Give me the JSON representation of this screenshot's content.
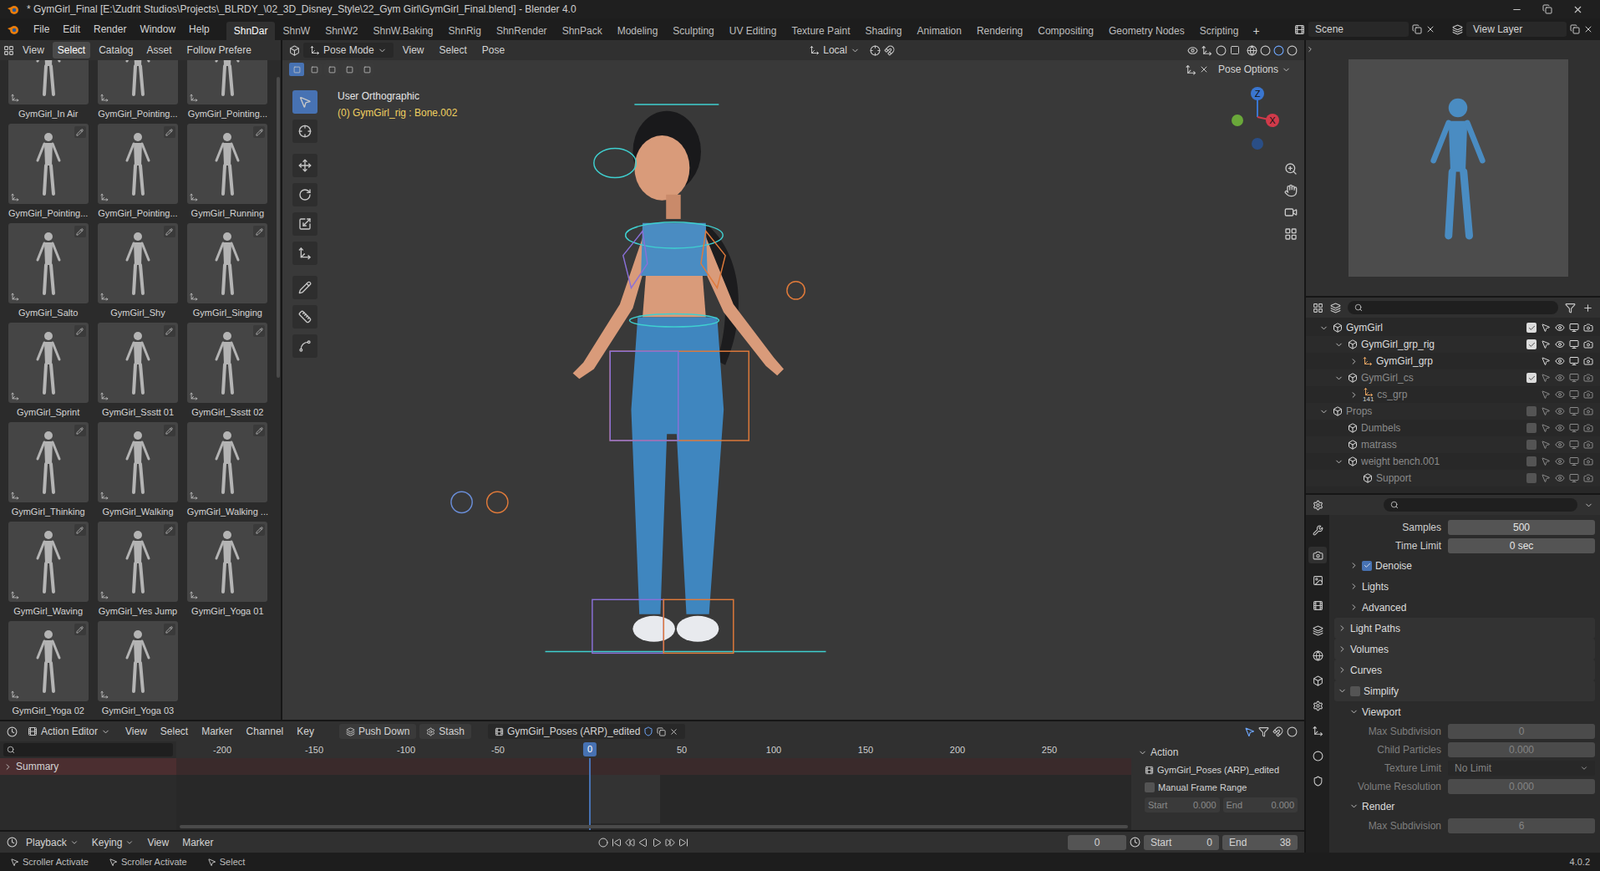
{
  "window": {
    "title": "* GymGirl_Final [E:\\Zudrit Studios\\Projects\\_BLRDY_\\02_3D_Disney_Style\\22_Gym Girl\\GymGirl_Final.blend] - Blender 4.0"
  },
  "menu": [
    "File",
    "Edit",
    "Render",
    "Window",
    "Help"
  ],
  "workspaces": [
    {
      "label": "ShnDar",
      "selected": true
    },
    {
      "label": "ShnW",
      "selected": false
    },
    {
      "label": "ShnW2",
      "selected": false
    },
    {
      "label": "ShnW.Baking",
      "selected": false
    },
    {
      "label": "ShnRig",
      "selected": false
    },
    {
      "label": "ShnRender",
      "selected": false
    },
    {
      "label": "ShnPack",
      "selected": false
    },
    {
      "label": "Modeling",
      "selected": false
    },
    {
      "label": "Sculpting",
      "selected": false
    },
    {
      "label": "UV Editing",
      "selected": false
    },
    {
      "label": "Texture Paint",
      "selected": false
    },
    {
      "label": "Shading",
      "selected": false
    },
    {
      "label": "Animation",
      "selected": false
    },
    {
      "label": "Rendering",
      "selected": false
    },
    {
      "label": "Compositing",
      "selected": false
    },
    {
      "label": "Geometry Nodes",
      "selected": false
    },
    {
      "label": "Scripting",
      "selected": false
    }
  ],
  "add_workspace": "+",
  "scene": "Scene",
  "view_layer": "View Layer",
  "asset_browser": {
    "menu": [
      {
        "label": "View",
        "selected": false
      },
      {
        "label": "Select",
        "selected": true
      },
      {
        "label": "Catalog",
        "selected": false
      },
      {
        "label": "Asset",
        "selected": false
      }
    ],
    "follow": "Follow Prefere",
    "assets": [
      "GymGirl_In Air",
      "GymGirl_Pointing...",
      "GymGirl_Pointing...",
      "GymGirl_Pointing...",
      "GymGirl_Pointing...",
      "GymGirl_Running",
      "GymGirl_Salto",
      "GymGirl_Shy",
      "GymGirl_Singing",
      "GymGirl_Sprint",
      "GymGirl_Ssstt 01",
      "GymGirl_Ssstt 02",
      "GymGirl_Thinking",
      "GymGirl_Walking",
      "GymGirl_Walking ...",
      "GymGirl_Waving",
      "GymGirl_Yes Jump",
      "GymGirl_Yoga 01",
      "GymGirl_Yoga 02",
      "GymGirl_Yoga 03"
    ]
  },
  "viewport": {
    "mode": "Pose Mode",
    "menu": [
      "View",
      "Select",
      "Pose"
    ],
    "orientation": "Local",
    "options": "Pose Options",
    "view_name": "User Orthographic",
    "active": "(0) GymGirl_rig : Bone.002",
    "gizmo_z": "Z",
    "gizmo_x": "X"
  },
  "outliner": {
    "items": [
      {
        "name": "GymGirl",
        "kind": "collection",
        "depth": 0,
        "has_children": true,
        "expanded": true,
        "checked": true,
        "disabled": false
      },
      {
        "name": "GymGirl_grp_rig",
        "kind": "collection",
        "depth": 1,
        "has_children": true,
        "expanded": true,
        "checked": true,
        "disabled": false
      },
      {
        "name": "GymGirl_grp",
        "kind": "object",
        "depth": 2,
        "has_children": true,
        "expanded": false,
        "disabled": false
      },
      {
        "name": "GymGirl_cs",
        "kind": "collection",
        "depth": 1,
        "has_children": true,
        "expanded": true,
        "checked": true,
        "disabled": true
      },
      {
        "name": "cs_grp",
        "kind": "object",
        "depth": 2,
        "has_children": true,
        "expanded": false,
        "disabled": true,
        "count": "141"
      },
      {
        "name": "Props",
        "kind": "collection",
        "depth": 0,
        "has_children": true,
        "expanded": true,
        "checked": false,
        "disabled": true
      },
      {
        "name": "Dumbels",
        "kind": "collection",
        "depth": 1,
        "has_children": false,
        "expanded": false,
        "checked": false,
        "disabled": true
      },
      {
        "name": "matrass",
        "kind": "collection",
        "depth": 1,
        "has_children": false,
        "expanded": false,
        "checked": false,
        "disabled": true
      },
      {
        "name": "weight bench.001",
        "kind": "collection",
        "depth": 1,
        "has_children": true,
        "expanded": true,
        "checked": false,
        "disabled": true
      },
      {
        "name": "Support",
        "kind": "collection",
        "depth": 2,
        "has_children": false,
        "expanded": false,
        "checked": false,
        "disabled": true
      }
    ]
  },
  "properties": {
    "items": [
      {
        "kind": "field",
        "label": "Samples",
        "value": "500",
        "disabled": false
      },
      {
        "kind": "field",
        "label": "Time Limit",
        "value": "0 sec",
        "disabled": false
      },
      {
        "kind": "section",
        "label": "Denoise",
        "depth": 1,
        "expanded": false,
        "checkbox": true,
        "checked": true
      },
      {
        "kind": "section",
        "label": "Lights",
        "depth": 1,
        "expanded": false,
        "checkbox": false,
        "checked": false
      },
      {
        "kind": "section",
        "label": "Advanced",
        "depth": 1,
        "expanded": false,
        "checkbox": false,
        "checked": false
      },
      {
        "kind": "section",
        "label": "Light Paths",
        "depth": 0,
        "expanded": false,
        "checkbox": false,
        "checked": false
      },
      {
        "kind": "section",
        "label": "Volumes",
        "depth": 0,
        "expanded": false,
        "checkbox": false,
        "checked": false
      },
      {
        "kind": "section",
        "label": "Curves",
        "depth": 0,
        "expanded": false,
        "checkbox": false,
        "checked": false
      },
      {
        "kind": "section",
        "label": "Simplify",
        "depth": 0,
        "expanded": true,
        "checkbox": true,
        "checked": false
      },
      {
        "kind": "section",
        "label": "Viewport",
        "depth": 1,
        "expanded": true,
        "checkbox": false,
        "checked": false
      },
      {
        "kind": "field",
        "label": "Max Subdivision",
        "value": "0",
        "disabled": true
      },
      {
        "kind": "field",
        "label": "Child Particles",
        "value": "0.000",
        "disabled": true
      },
      {
        "kind": "dropdown",
        "label": "Texture Limit",
        "value": "No Limit",
        "disabled": true
      },
      {
        "kind": "field",
        "label": "Volume Resolution",
        "value": "0.000",
        "disabled": true
      },
      {
        "kind": "section",
        "label": "Render",
        "depth": 1,
        "expanded": true,
        "checkbox": false,
        "checked": false
      },
      {
        "kind": "field",
        "label": "Max Subdivision",
        "value": "6",
        "disabled": true
      }
    ]
  },
  "action_editor": {
    "mode": "Action Editor",
    "menu": [
      "View",
      "Select",
      "Marker",
      "Channel",
      "Key"
    ],
    "push_down": "Push Down",
    "stash": "Stash",
    "action": "GymGirl_Poses (ARP)_edited",
    "ticks": [
      "-200",
      "-150",
      "-100",
      "-50",
      "0",
      "50",
      "100",
      "150",
      "200",
      "250"
    ],
    "current_frame": "0",
    "channels": [
      "Summary"
    ],
    "side": {
      "tab": "Action",
      "action": "GymGirl_Poses (ARP)_edited",
      "manual_range": {
        "label": "Manual Frame Range",
        "checked": false
      },
      "start": {
        "label": "Start",
        "value": "0.000"
      },
      "end": {
        "label": "End",
        "value": "0.000"
      }
    }
  },
  "playback": {
    "menu": [
      "Playback",
      "Keying",
      "View",
      "Marker"
    ],
    "frame": "0",
    "start": {
      "label": "Start",
      "value": "0"
    },
    "end": {
      "label": "End",
      "value": "38"
    }
  },
  "status_bar": {
    "items": [
      "Scroller Activate",
      "Scroller Activate",
      "Select"
    ],
    "version": "4.0.2"
  }
}
